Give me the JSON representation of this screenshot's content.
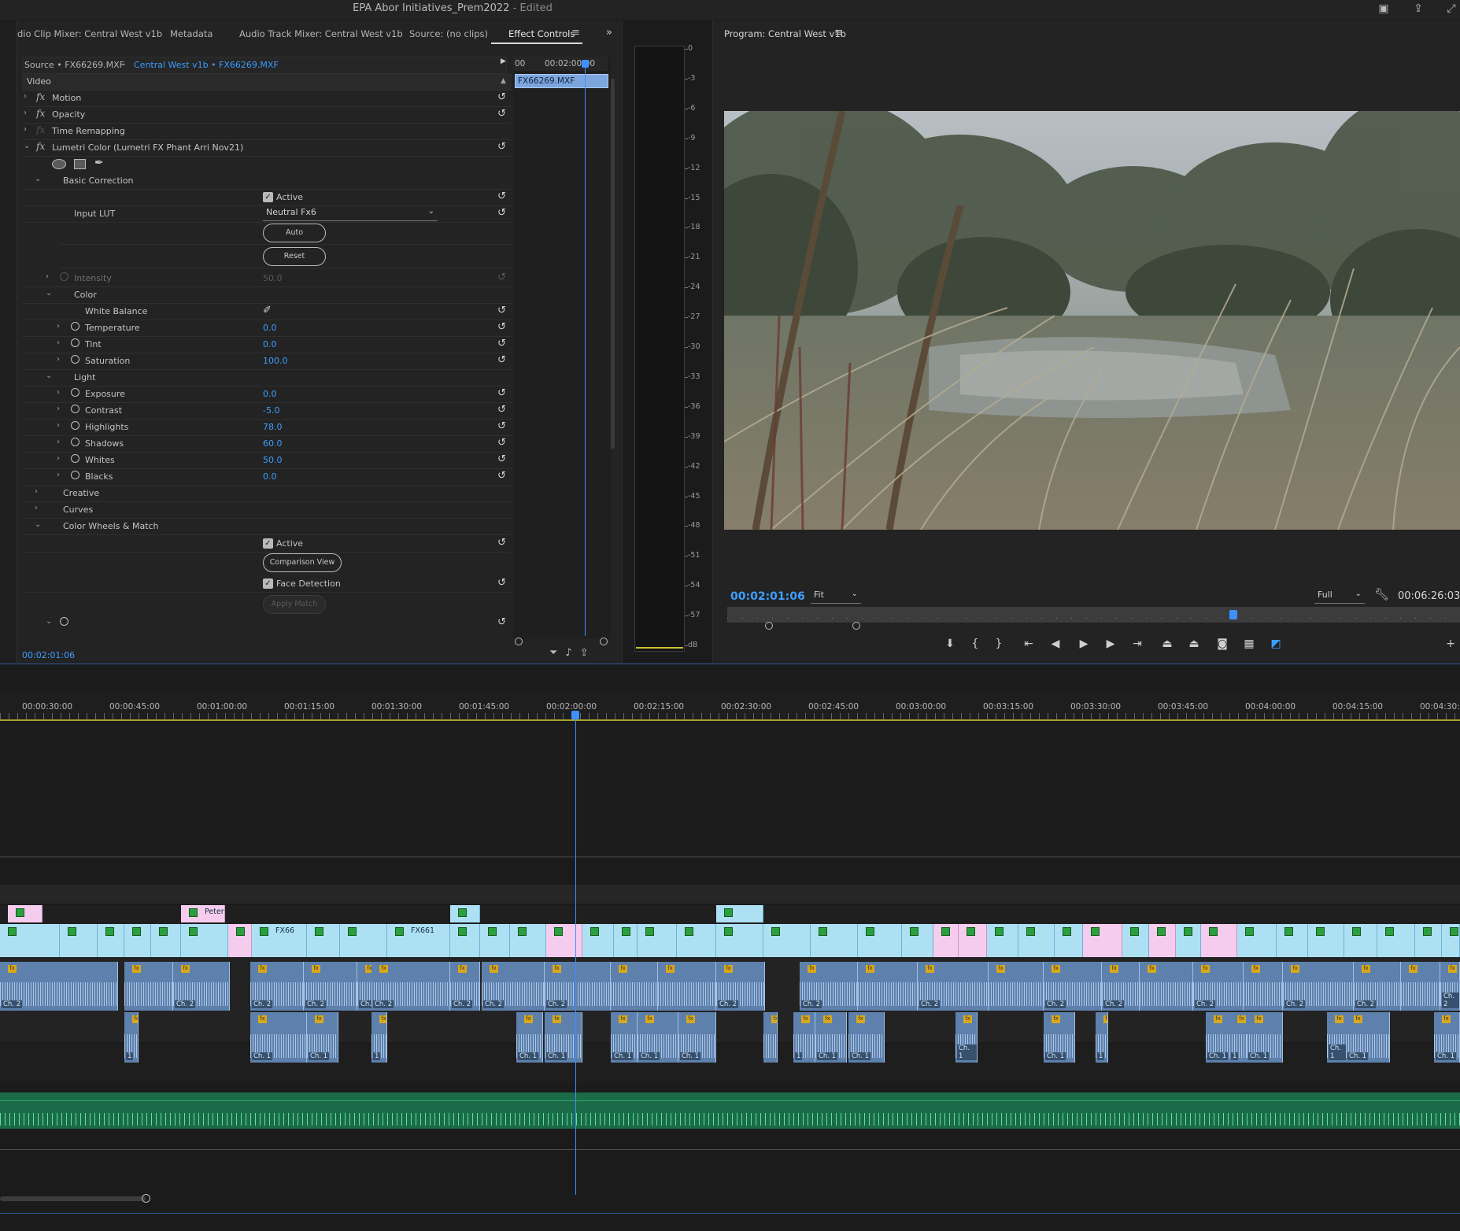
{
  "app": {
    "title": "EPA Abor Initiatives_Prem2022",
    "status": "- Edited"
  },
  "tabs": [
    {
      "label": "dio Clip Mixer: Central West v1b"
    },
    {
      "label": "Metadata"
    },
    {
      "label": "Audio Track Mixer: Central West v1b"
    },
    {
      "label": "Source: (no clips)"
    },
    {
      "label": "Effect Controls"
    }
  ],
  "effect_controls": {
    "source_label": "Source • FX66269.MXF",
    "sequence_label": "Central West v1b • FX66269.MXF",
    "ruler_timecode": "00:02:00:00",
    "ruler_start": "00",
    "clip_name": "FX66269.MXF",
    "video_header": "Video",
    "motion": "Motion",
    "opacity": "Opacity",
    "time_remapping": "Time Remapping",
    "lumetri": "Lumetri Color (Lumetri FX Phant Arri Nov21)",
    "basic_correction": "Basic Correction",
    "active_label": "Active",
    "input_lut_label": "Input LUT",
    "input_lut_value": "Neutral Fx6",
    "auto_button": "Auto",
    "reset_button": "Reset",
    "intensity_label": "Intensity",
    "intensity_value": "50.0",
    "color_group": "Color",
    "white_balance": "White Balance",
    "temperature_label": "Temperature",
    "temperature_value": "0.0",
    "tint_label": "Tint",
    "tint_value": "0.0",
    "saturation_label": "Saturation",
    "saturation_value": "100.0",
    "light_group": "Light",
    "exposure_label": "Exposure",
    "exposure_value": "0.0",
    "contrast_label": "Contrast",
    "contrast_value": "-5.0",
    "highlights_label": "Highlights",
    "highlights_value": "78.0",
    "shadows_label": "Shadows",
    "shadows_value": "60.0",
    "whites_label": "Whites",
    "whites_value": "50.0",
    "blacks_label": "Blacks",
    "blacks_value": "0.0",
    "creative": "Creative",
    "curves": "Curves",
    "color_wheels": "Color Wheels & Match",
    "active2_label": "Active",
    "comparison_view_button": "Comparison View",
    "face_detection_label": "Face Detection",
    "apply_match_button": "Apply Match",
    "timecode": "00:02:01:06"
  },
  "audio_meter": {
    "labels": [
      "0",
      "-3",
      "-6",
      "-9",
      "-12",
      "-15",
      "-18",
      "-21",
      "-24",
      "-27",
      "-30",
      "-33",
      "-36",
      "-39",
      "-42",
      "-45",
      "-48",
      "-51",
      "-54",
      "-57",
      "dB"
    ]
  },
  "program": {
    "title": "Program: Central West v1b",
    "timecode": "00:02:01:06",
    "fit_select": "Fit",
    "quality_select": "Full",
    "duration": "00:06:26:03"
  },
  "timeline": {
    "ruler_labels": [
      "00:00:30:00",
      "00:00:45:00",
      "00:01:00:00",
      "00:01:15:00",
      "00:01:30:00",
      "00:01:45:00",
      "00:02:00:00",
      "00:02:15:00",
      "00:02:30:00",
      "00:02:45:00",
      "00:03:00:00",
      "00:03:15:00",
      "00:03:30:00",
      "00:03:45:00",
      "00:04:00:00",
      "00:04:15:00",
      "00:04:30:0"
    ],
    "clip_labels": {
      "peter": "Peter",
      "fx66": "FX66",
      "fx661": "FX661",
      "ch2": "Ch. 2",
      "ch1": "Ch. 1",
      "n1": "1"
    }
  },
  "colors": {
    "accent": "#3e9eff",
    "video_clip": "#aee0f4",
    "video_clip_alt": "#f6ccee",
    "audio_clip": "#5d80ac",
    "music_track": "#1b6b48"
  }
}
